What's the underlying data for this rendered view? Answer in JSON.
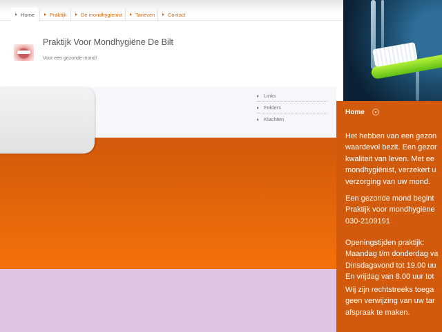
{
  "nav": {
    "items": [
      {
        "label": "Home"
      },
      {
        "label": "Praktijk"
      },
      {
        "label": "De mondhygienist"
      },
      {
        "label": "Tarieven"
      },
      {
        "label": "Contact"
      }
    ]
  },
  "header": {
    "title": "Praktijk Voor Mondhygiëne De Bilt",
    "tagline": "Voor een gezonde mond!"
  },
  "sidebar": {
    "links": [
      {
        "label": "Links"
      },
      {
        "label": "Folders"
      },
      {
        "label": "Klachten"
      }
    ]
  },
  "right_panel": {
    "title": "Home",
    "lines": [
      "Het hebben van een gezon",
      "waardevol bezit. Een gezor",
      "kwaliteit van leven. Met ee",
      "mondhygiënist, verzekert u",
      "verzorging van uw mond.",
      "Een gezonde mond begint",
      "Praktijk voor mondhygiëne",
      "030-2109191",
      "Openingstijden praktijk:",
      "Maandag t/m donderdag va",
      "Dinsdagavond tot 19.00 uu",
      "En vrijdag van 8.00 uur tot",
      "Wij zijn rechtstreeks toega",
      "geen verwijzing van uw tar",
      "afspraak te maken."
    ]
  },
  "colors": {
    "accent": "#d25a0c",
    "nav_link": "#d46a14",
    "lower_band": "#e0c4e4"
  }
}
